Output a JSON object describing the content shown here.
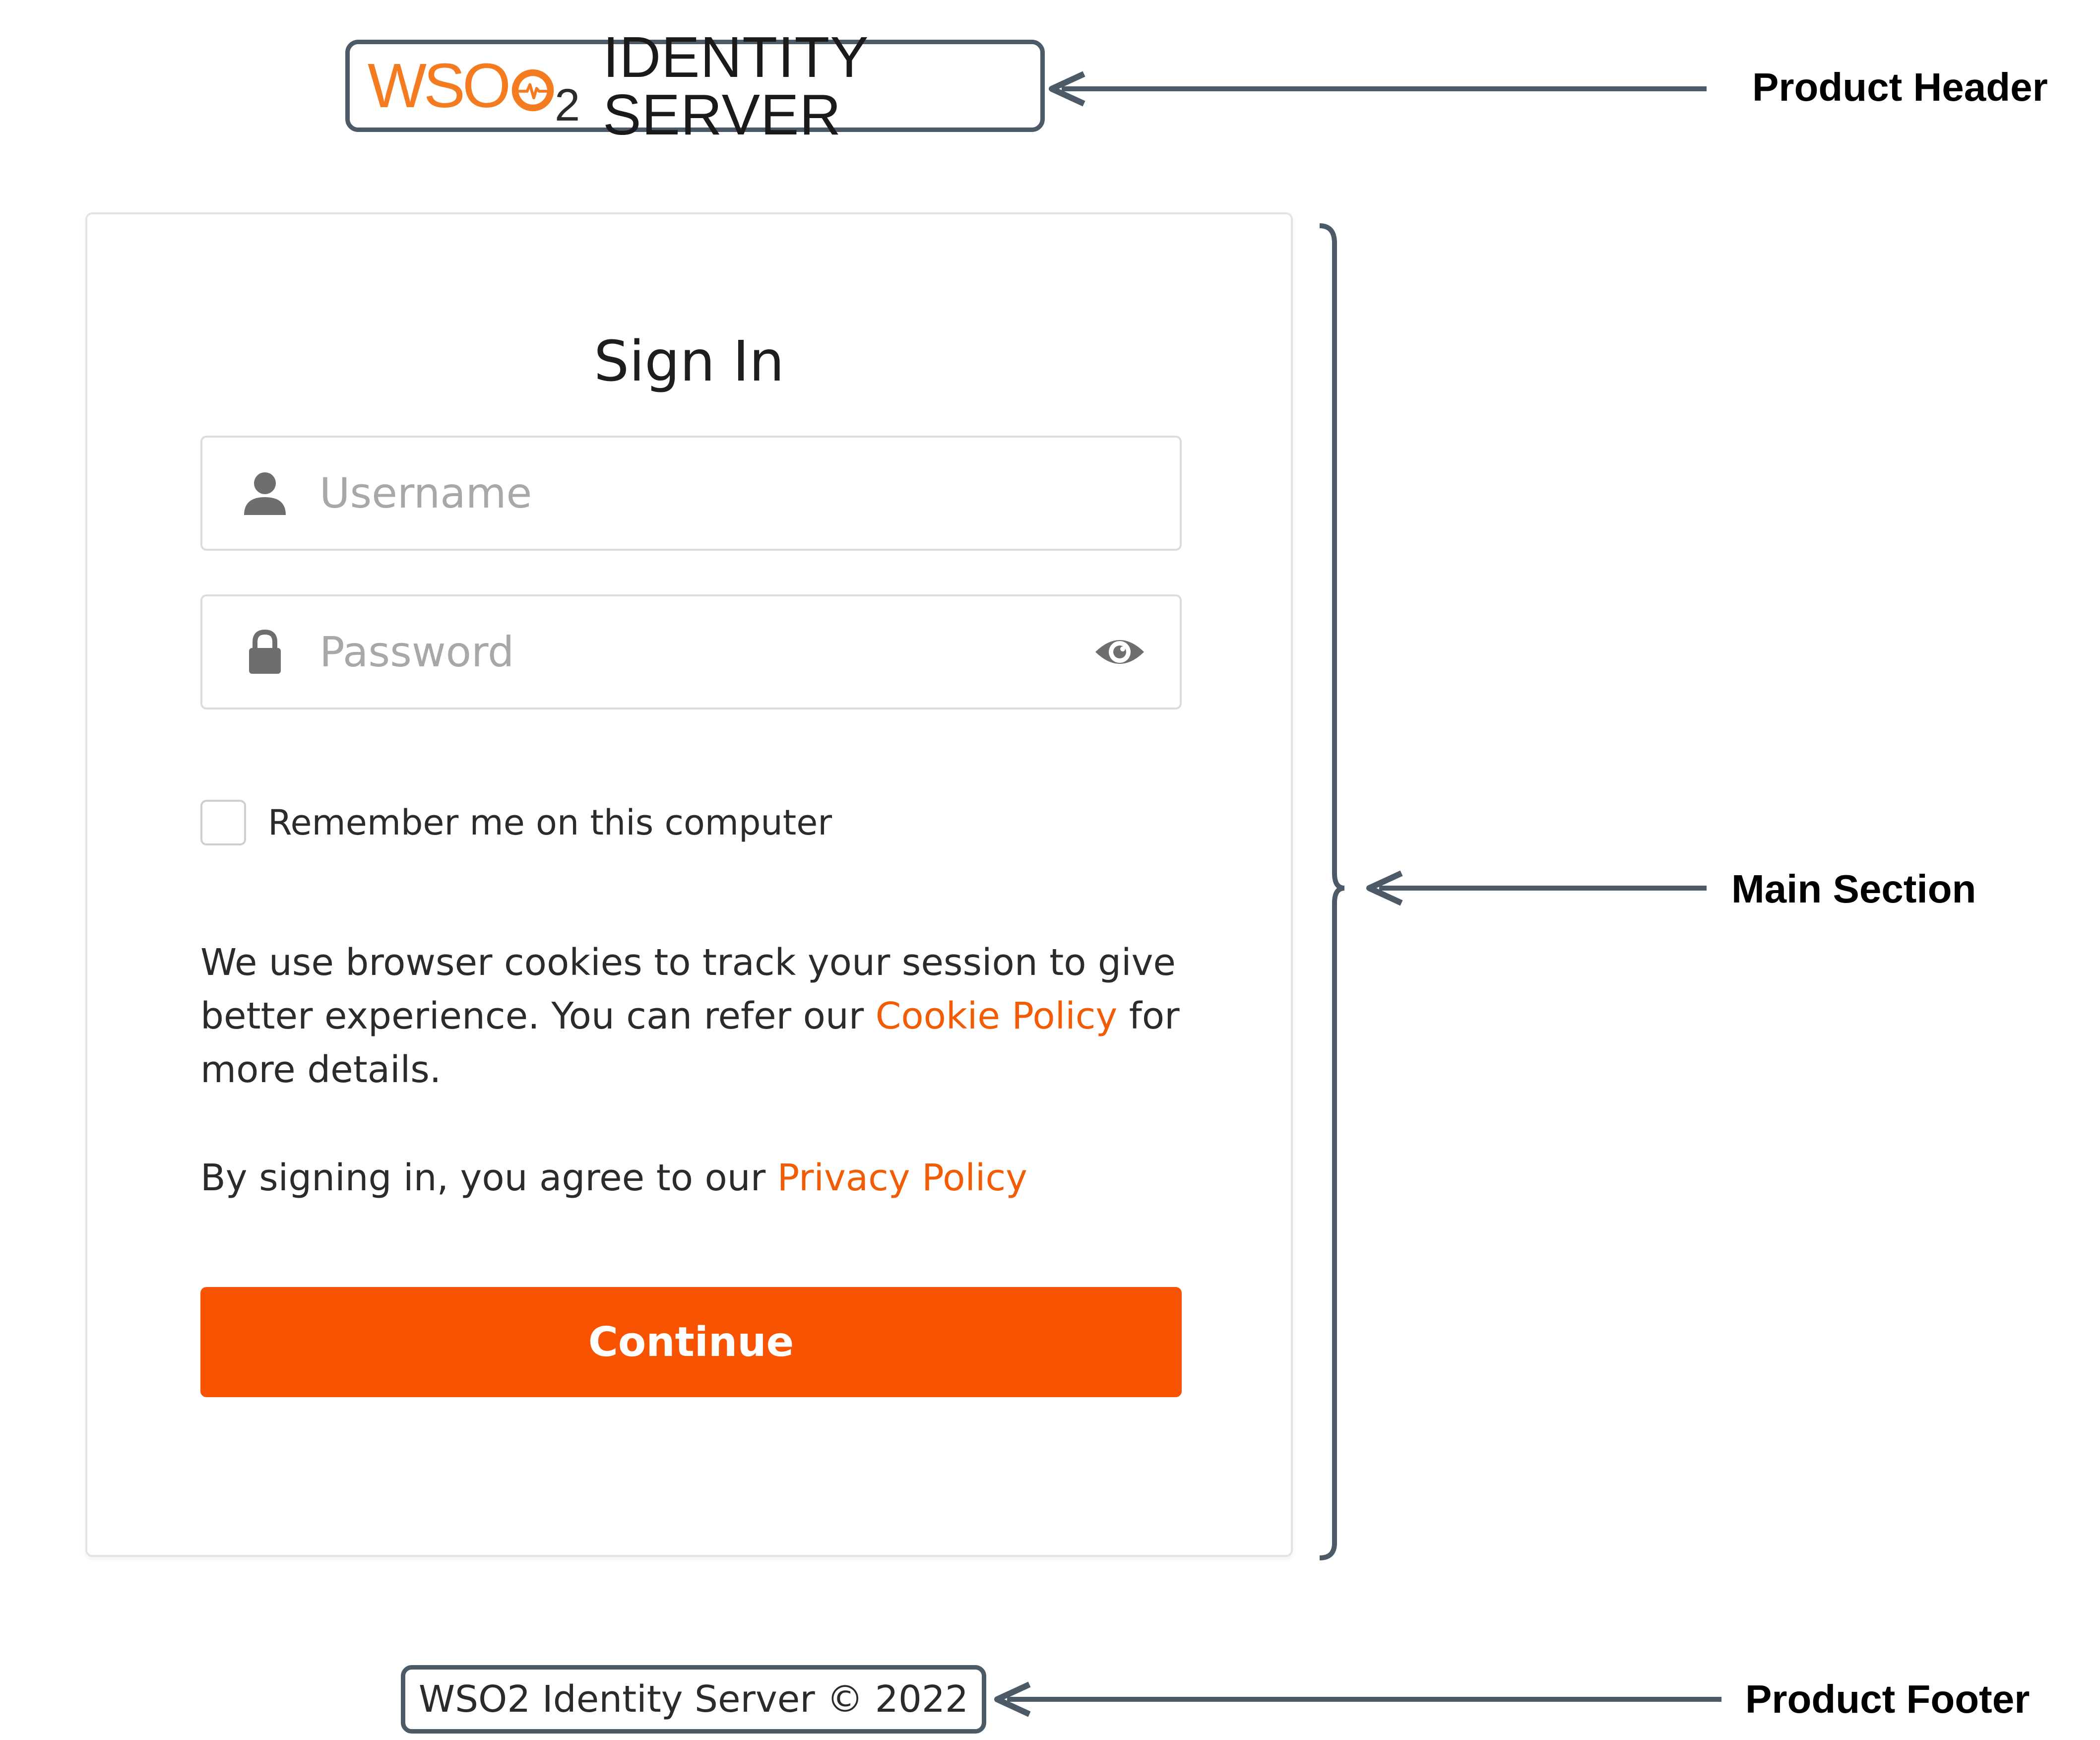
{
  "header": {
    "logo_wso": "WSO",
    "logo_sub": "2",
    "product_name": "IDENTITY SERVER"
  },
  "annotations": {
    "product_header": "Product Header",
    "main_section": "Main Section",
    "product_footer": "Product Footer"
  },
  "login": {
    "title": "Sign In",
    "username_placeholder": "Username",
    "password_placeholder": "Password",
    "remember_label": "Remember me on this computer",
    "cookie_text_before": "We use browser cookies to track your session to give better experience. You can refer our ",
    "cookie_link": "Cookie Policy",
    "cookie_text_after": " for more details.",
    "privacy_text_before": "By signing in, you agree to our ",
    "privacy_link": "Privacy Policy",
    "continue_label": "Continue"
  },
  "footer": {
    "text": "WSO2 Identity Server © 2022"
  },
  "colors": {
    "brand_orange": "#f75300",
    "link_orange": "#f25c05",
    "logo_orange": "#f47b20",
    "annotation_slate": "#4c5a68"
  },
  "icons": {
    "username": "user-icon",
    "password": "lock-icon",
    "show_password": "eye-icon",
    "logo_mark": "wso2-o-logo-icon"
  }
}
